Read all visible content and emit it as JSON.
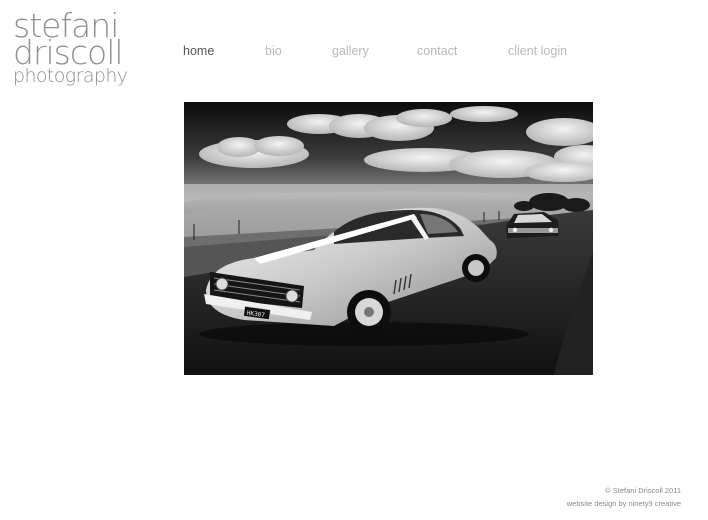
{
  "logo": {
    "line1": "stefani",
    "line2": "driscoll",
    "line3": "photography"
  },
  "nav": {
    "items": [
      {
        "label": "home",
        "active": true
      },
      {
        "label": "bio",
        "active": false
      },
      {
        "label": "gallery",
        "active": false
      },
      {
        "label": "contact",
        "active": false
      },
      {
        "label": "client login",
        "active": false
      }
    ]
  },
  "photo": {
    "plate": "HK307"
  },
  "footer": {
    "copyright": "© Stefani Driscoll 2011",
    "credit": "website design by ninety9 creative"
  },
  "colors": {
    "nav_active": "#555555",
    "nav_inactive": "#b8b8b8",
    "logo": "#8f8f8f"
  }
}
